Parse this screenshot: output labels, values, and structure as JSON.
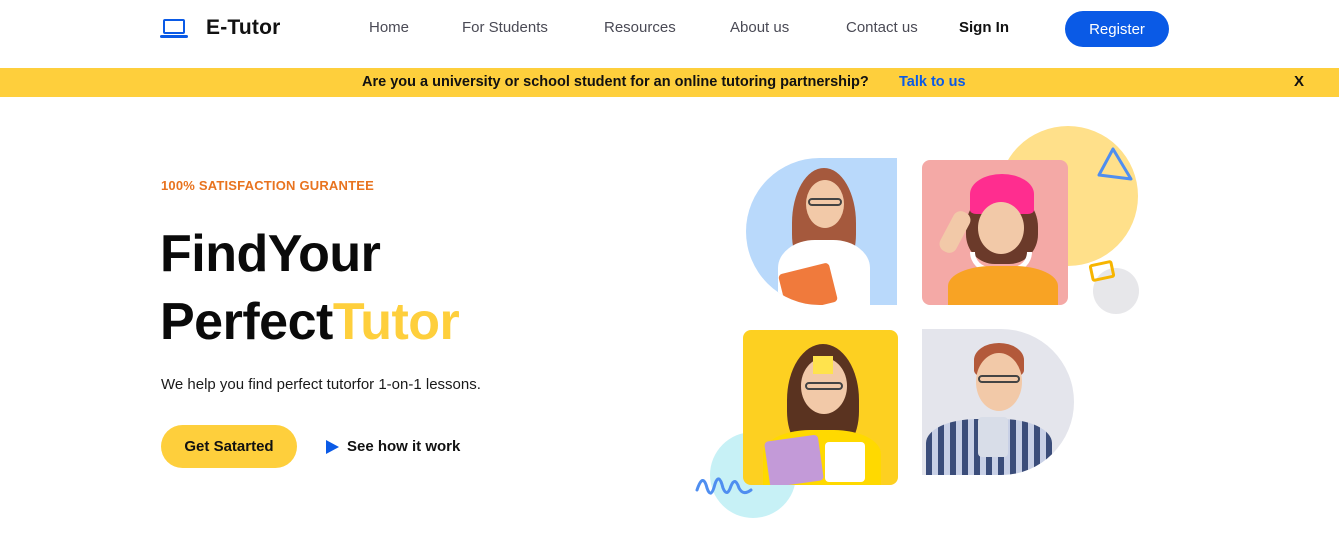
{
  "brand": {
    "name": "E-Tutor",
    "icon": "laptop-icon",
    "color": "#0a5ae6"
  },
  "nav": {
    "items": [
      {
        "label": "Home"
      },
      {
        "label": "For Students"
      },
      {
        "label": "Resources"
      },
      {
        "label": "About us"
      },
      {
        "label": "Contact us"
      }
    ],
    "signin_label": "Sign In",
    "register_label": "Register"
  },
  "banner": {
    "text": "Are you a university or school student for an online tutoring partnership?",
    "link_label": "Talk to us",
    "close_label": "X",
    "background": "#fecf3c"
  },
  "hero": {
    "eyebrow": "100% SATISFACTION GURANTEE",
    "headline_line1": "FindYour",
    "headline_line2_plain": "Perfect",
    "headline_line2_accent": "Tutor",
    "subtext": "We help you find perfect tutorfor 1-on-1 lessons.",
    "cta_label": "Get Satarted",
    "secondary_label": "See how it work",
    "secondary_icon": "play-icon",
    "accent_color": "#fecf3c",
    "eyebrow_color": "#e8731f"
  },
  "illustration": {
    "photos": [
      {
        "name": "student-photo-1",
        "bg": "#b9d9fb"
      },
      {
        "name": "student-photo-2",
        "bg": "#f4a9a6"
      },
      {
        "name": "student-photo-3",
        "bg": "#fdd021"
      },
      {
        "name": "student-photo-4",
        "bg": "#e4e5ec"
      }
    ]
  }
}
